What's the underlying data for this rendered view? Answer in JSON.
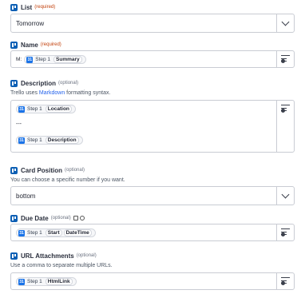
{
  "fields": {
    "list": {
      "label": "List",
      "qualifier": "(required)",
      "value": "Tomorrow"
    },
    "name": {
      "label": "Name",
      "qualifier": "(required)",
      "prefix": "M:",
      "step": "Step 1",
      "tag": "Summary"
    },
    "description": {
      "label": "Description",
      "qualifier": "(optional)",
      "help_before": "Trello uses ",
      "help_link": "Markdown",
      "help_after": " formatting syntax.",
      "step1": "Step 1",
      "tag1": "Location",
      "separator": "---",
      "step2": "Step 1",
      "tag2": "Description"
    },
    "card_position": {
      "label": "Card Position",
      "qualifier": "(optional)",
      "help": "You can choose a specific number if you want.",
      "value": "bottom"
    },
    "due_date": {
      "label": "Due Date",
      "qualifier": "(optional)",
      "step": "Step 1",
      "tag1": "Start",
      "tag2": "DateTime"
    },
    "url_attachments": {
      "label": "URL Attachments",
      "qualifier": "(optional)",
      "help": "Use a comma to separate multiple URLs.",
      "step": "Step 1",
      "tag": "HtmlLink"
    }
  },
  "calendar_badge_text": "31",
  "colors": {
    "trello_blue": "#0c5fb4",
    "required": "#c2410c",
    "link": "#2563eb",
    "calendar_blue": "#1a73e8"
  }
}
